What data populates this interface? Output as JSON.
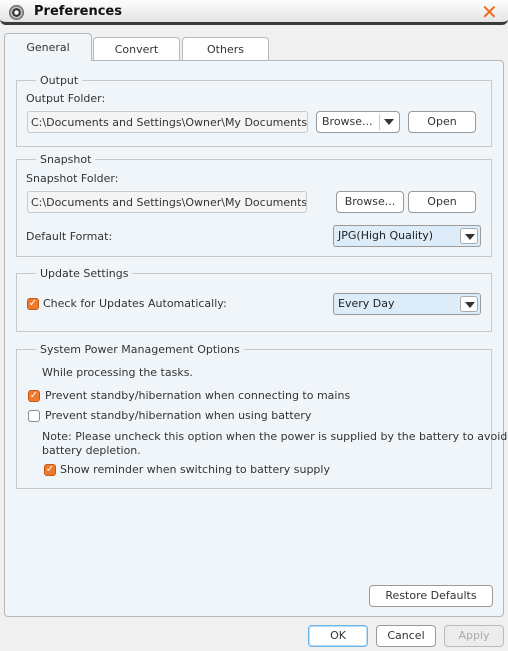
{
  "window": {
    "title": "Preferences"
  },
  "tabs": [
    {
      "label": "General",
      "active": true
    },
    {
      "label": "Convert"
    },
    {
      "label": "Others"
    }
  ],
  "output": {
    "group": "Output",
    "folder_label": "Output Folder:",
    "folder_value": "C:\\Documents and Settings\\Owner\\My Documents\\My Vid",
    "browse": "Browse...",
    "open": "Open"
  },
  "snapshot": {
    "group": "Snapshot",
    "folder_label": "Snapshot Folder:",
    "folder_value": "C:\\Documents and Settings\\Owner\\My Documents\\My Pict",
    "browse": "Browse...",
    "open": "Open",
    "format_label": "Default Format:",
    "format_value": "JPG(High Quality)"
  },
  "update": {
    "group": "Update Settings",
    "check_label": "Check for Updates Automatically:",
    "checked": true,
    "frequency": "Every Day"
  },
  "power": {
    "group": "System Power Management Options",
    "intro": "While processing the tasks.",
    "mains_label": "Prevent standby/hibernation when connecting to mains",
    "mains_checked": true,
    "battery_label": "Prevent standby/hibernation when using battery",
    "battery_checked": false,
    "note_line1": "Note: Please uncheck this option when the power is supplied by the battery to avoid",
    "note_line2": "battery depletion.",
    "reminder_label": "Show reminder when switching to battery supply",
    "reminder_checked": true
  },
  "buttons": {
    "restore": "Restore Defaults",
    "ok": "OK",
    "cancel": "Cancel",
    "apply": "Apply"
  },
  "colors": {
    "accent": "#ef6a1c",
    "panel": "#f0f5fa"
  }
}
